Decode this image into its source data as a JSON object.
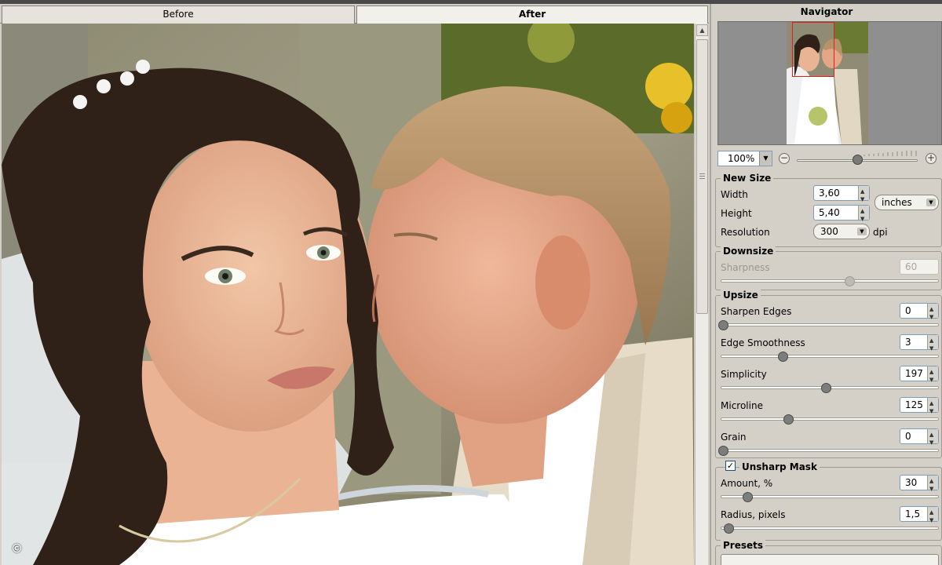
{
  "tabs": [
    {
      "label": "Before",
      "active": false
    },
    {
      "label": "After",
      "active": true
    }
  ],
  "viewport": {
    "image_description_icon": "photo-canvas",
    "copyright_symbol": "©"
  },
  "navigator": {
    "title": "Navigator",
    "zoom_value": "100%",
    "minus": "−",
    "plus": "+",
    "zoom_level": 0.5
  },
  "new_size": {
    "title": "New Size",
    "width_label": "Width",
    "width_value": "3,60",
    "height_label": "Height",
    "height_value": "5,40",
    "unit_value": "inches",
    "resolution_label": "Resolution",
    "resolution_value": "300",
    "resolution_unit": "dpi"
  },
  "downsize": {
    "title": "Downsize",
    "sharpness_label": "Sharpness",
    "sharpness_value": "60",
    "sharpness_level": 0.6
  },
  "upsize": {
    "title": "Upsize",
    "sharpen_edges_label": "Sharpen Edges",
    "sharpen_edges_value": "0",
    "sharpen_edges_level": 0.0,
    "edge_smoothness_label": "Edge Smoothness",
    "edge_smoothness_value": "3",
    "edge_smoothness_level": 0.28,
    "simplicity_label": "Simplicity",
    "simplicity_value": "197",
    "simplicity_level": 0.5,
    "microline_label": "Microline",
    "microline_value": "125",
    "microline_level": 0.3,
    "grain_label": "Grain",
    "grain_value": "0",
    "grain_level": 0.0
  },
  "unsharp_mask": {
    "title": "Unsharp Mask",
    "checked_glyph": "✓",
    "amount_label": "Amount, %",
    "amount_value": "30",
    "amount_level": 0.12,
    "radius_label": "Radius, pixels",
    "radius_value": "1,5",
    "radius_level": 0.02
  },
  "presets": {
    "title": "Presets"
  },
  "colors": {
    "panel_bg": "#d4d0c8",
    "navigator_bg": "#8f8f8f",
    "nav_rect": "#e02020"
  }
}
